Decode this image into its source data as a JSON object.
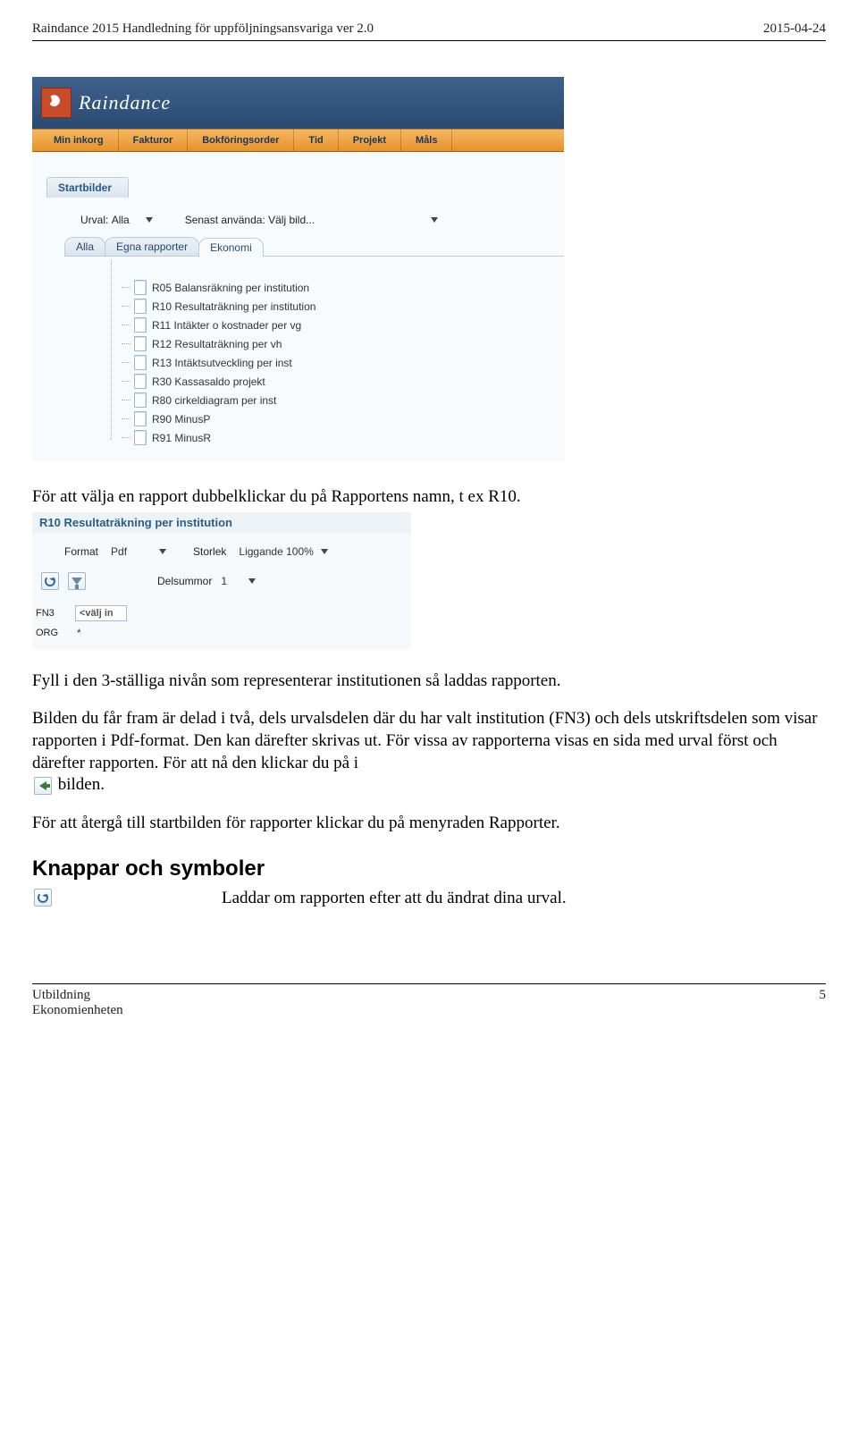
{
  "page_header": {
    "left": "Raindance 2015 Handledning för uppföljningsansvariga ver 2.0",
    "right": "2015-04-24"
  },
  "shot1": {
    "brand": "Raindance",
    "menu": [
      "Min inkorg",
      "Fakturor",
      "Bokföringsorder",
      "Tid",
      "Projekt",
      "Måls"
    ],
    "section_tab": "Startbilder",
    "urval_label": "Urval:",
    "urval_value": "Alla",
    "senast_label": "Senast använda:",
    "senast_value": "Välj bild...",
    "tabs": [
      "Alla",
      "Egna rapporter",
      "Ekonomi"
    ],
    "reports": [
      "R05 Balansräkning per institution",
      "R10 Resultaträkning per institution",
      "R11 Intäkter o kostnader per vg",
      "R12 Resultaträkning per vh",
      "R13 Intäktsutveckling per inst",
      "R30 Kassasaldo projekt",
      "R80 cirkeldiagram per inst",
      "R90 MinusP",
      "R91 MinusR"
    ]
  },
  "para1": "För att välja en rapport dubbelklickar du på Rapportens namn, t ex R10.",
  "shot2": {
    "title": "R10 Resultaträkning per institution",
    "format_label": "Format",
    "format_value": "Pdf",
    "storlek_label": "Storlek",
    "storlek_value": "Liggande 100%",
    "delsummor_label": "Delsummor",
    "delsummor_value": "1",
    "rows": [
      {
        "label": "FN3",
        "value": "<välj in"
      },
      {
        "label": "ORG",
        "value": "*"
      }
    ]
  },
  "para2": "Fyll i den 3-ställiga nivån som representerar institutionen så laddas rapporten.",
  "para3": "Bilden du får fram är delad i två, dels urvalsdelen där du har valt institution (FN3) och dels utskriftsdelen som visar rapporten i Pdf-format. Den kan därefter skrivas ut. För vissa av rapporterna visas en sida med urval först och därefter rapporten. För att nå den klickar du på i",
  "para3_tail": " bilden.",
  "para4": "För att återgå till startbilden för rapporter klickar du på menyraden Rapporter.",
  "heading": "Knappar och symboler",
  "symbol_desc": "Laddar om rapporten efter att du ändrat dina urval.",
  "footer": {
    "line1": "Utbildning",
    "line2": "Ekonomienheten",
    "page": "5"
  }
}
